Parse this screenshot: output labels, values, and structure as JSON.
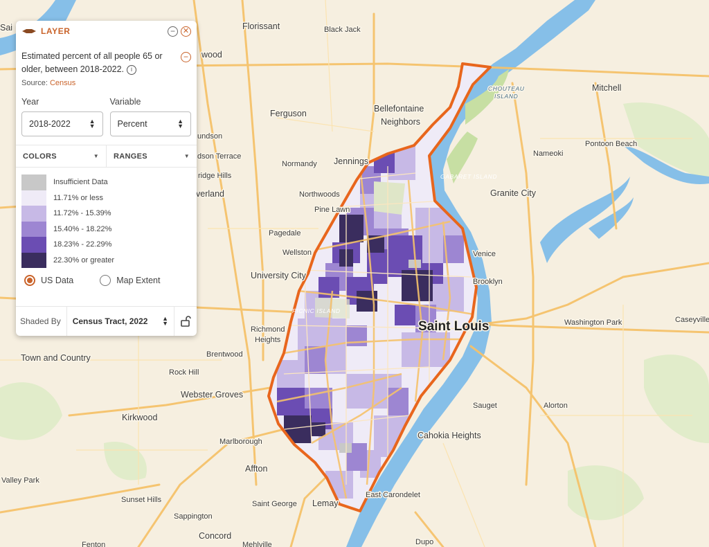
{
  "map": {
    "places": [
      {
        "name": "Florissant",
        "cls": ""
      },
      {
        "name": "Black Jack",
        "cls": "small"
      },
      {
        "name": "Ferguson",
        "cls": ""
      },
      {
        "name": "Bellefontaine",
        "cls": ""
      },
      {
        "name": "Neighbors",
        "cls": ""
      },
      {
        "name": "Mitchell",
        "cls": ""
      },
      {
        "name": "Jennings",
        "cls": ""
      },
      {
        "name": "Normandy",
        "cls": "small"
      },
      {
        "name": "Nameoki",
        "cls": "small"
      },
      {
        "name": "Pontoon Beach",
        "cls": "small"
      },
      {
        "name": "Northwoods",
        "cls": "small"
      },
      {
        "name": "Granite City",
        "cls": ""
      },
      {
        "name": "Pine Lawn",
        "cls": "small"
      },
      {
        "name": "Pagedale",
        "cls": "small"
      },
      {
        "name": "Wellston",
        "cls": "small"
      },
      {
        "name": "Venice",
        "cls": "small"
      },
      {
        "name": "University City",
        "cls": ""
      },
      {
        "name": "Brooklyn",
        "cls": "small"
      },
      {
        "name": "Saint Louis",
        "cls": "big"
      },
      {
        "name": "Washington Park",
        "cls": "small"
      },
      {
        "name": "Caseyville",
        "cls": "small"
      },
      {
        "name": "Richmond",
        "cls": "small"
      },
      {
        "name": "Heights",
        "cls": "small"
      },
      {
        "name": "Brentwood",
        "cls": "small"
      },
      {
        "name": "Town and Country",
        "cls": ""
      },
      {
        "name": "Rock Hill",
        "cls": "small"
      },
      {
        "name": "Webster Groves",
        "cls": ""
      },
      {
        "name": "Sauget",
        "cls": "small"
      },
      {
        "name": "Alorton",
        "cls": "small"
      },
      {
        "name": "Kirkwood",
        "cls": ""
      },
      {
        "name": "Cahokia Heights",
        "cls": ""
      },
      {
        "name": "Marlborough",
        "cls": "small"
      },
      {
        "name": "Affton",
        "cls": ""
      },
      {
        "name": "Valley Park",
        "cls": "small"
      },
      {
        "name": "Sunset Hills",
        "cls": "small"
      },
      {
        "name": "East Carondelet",
        "cls": "small"
      },
      {
        "name": "Saint George",
        "cls": "small"
      },
      {
        "name": "Lemay",
        "cls": ""
      },
      {
        "name": "Sappington",
        "cls": "small"
      },
      {
        "name": "Concord",
        "cls": ""
      },
      {
        "name": "Dupo",
        "cls": "small"
      },
      {
        "name": "Fenton",
        "cls": "small"
      },
      {
        "name": "Mehlville",
        "cls": "small"
      },
      {
        "name": "wood",
        "cls": ""
      },
      {
        "name": "undson",
        "cls": "small"
      },
      {
        "name": "dson Terrace",
        "cls": "small"
      },
      {
        "name": "ridge Hills",
        "cls": "small"
      },
      {
        "name": "verland",
        "cls": ""
      },
      {
        "name": "Sai",
        "cls": ""
      }
    ],
    "river_labels": [
      "CHOUTEAU",
      "ISLAND",
      "GABARET ISLAND",
      "PICNIC ISLAND"
    ],
    "colors": {
      "insufficient": "#c8c8c8",
      "class1": "#efebf7",
      "class2": "#c7b9e6",
      "class3": "#9d86d2",
      "class4": "#6b4db3",
      "class5": "#3a2d5e",
      "boundary": "#e8661d",
      "water": "#86bfe8",
      "land": "#f6efe0",
      "highway": "#f5c26b"
    }
  },
  "panel": {
    "header_title": "LAYER",
    "description": "Estimated percent of all people 65 or older, between 2018-2022.",
    "source_label": "Source: ",
    "source_link": "Census",
    "year_label": "Year",
    "year_value": "2018-2022",
    "variable_label": "Variable",
    "variable_value": "Percent",
    "colors_tab": "COLORS",
    "ranges_tab": "RANGES",
    "legend": [
      {
        "label": "Insufficient Data",
        "color": "#c8c8c8"
      },
      {
        "label": "11.71% or less",
        "color": "#efebf7"
      },
      {
        "label": "11.72% - 15.39%",
        "color": "#c7b9e6"
      },
      {
        "label": "15.40% - 18.22%",
        "color": "#9d86d2"
      },
      {
        "label": "18.23% - 22.29%",
        "color": "#6b4db3"
      },
      {
        "label": "22.30% or greater",
        "color": "#3a2d5e"
      }
    ],
    "radio_us": "US Data",
    "radio_extent": "Map Extent",
    "shaded_by_label": "Shaded By",
    "shaded_by_value": "Census Tract, 2022"
  }
}
